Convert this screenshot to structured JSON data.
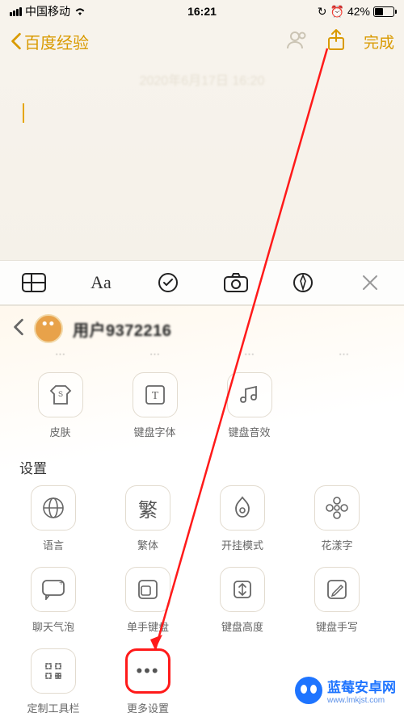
{
  "status": {
    "carrier": "中国移动",
    "time": "16:21",
    "battery": "42%"
  },
  "nav": {
    "back_label": "百度经验",
    "done_label": "完成"
  },
  "note": {
    "date_watermark": "2020年6月17日 16:20"
  },
  "ime": {
    "username": "用户9372216",
    "row1": [
      {
        "key": "skin",
        "label": "皮肤"
      },
      {
        "key": "font",
        "label": "键盘字体"
      },
      {
        "key": "sound",
        "label": "键盘音效"
      }
    ],
    "section_title": "设置",
    "settings": [
      {
        "key": "lang",
        "label": "语言"
      },
      {
        "key": "trad",
        "label": "繁体",
        "glyph": "繁"
      },
      {
        "key": "cheat",
        "label": "开挂模式"
      },
      {
        "key": "flower",
        "label": "花漾字"
      },
      {
        "key": "bubble",
        "label": "聊天气泡"
      },
      {
        "key": "onehand",
        "label": "单手键盘"
      },
      {
        "key": "height",
        "label": "键盘高度"
      },
      {
        "key": "handwrite",
        "label": "键盘手写"
      },
      {
        "key": "toolbar",
        "label": "定制工具栏"
      },
      {
        "key": "more",
        "label": "更多设置",
        "highlight": true
      }
    ]
  },
  "watermark": {
    "title": "蓝莓安卓网",
    "url": "www.lmkjst.com"
  }
}
